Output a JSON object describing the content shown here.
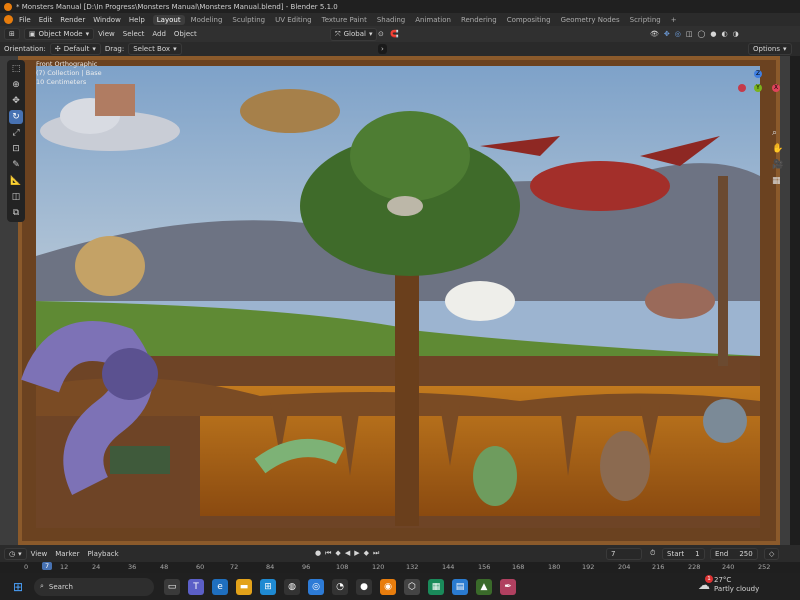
{
  "titlebar": {
    "title": "* Monsters Manual [D:\\In Progress\\Monsters Manual\\Monsters Manual.blend] - Blender 5.1.0"
  },
  "menu": {
    "items": [
      "File",
      "Edit",
      "Render",
      "Window",
      "Help"
    ]
  },
  "workspaces": [
    "Layout",
    "Modeling",
    "Sculpting",
    "UV Editing",
    "Texture Paint",
    "Shading",
    "Animation",
    "Rendering",
    "Compositing",
    "Geometry Nodes",
    "Scripting"
  ],
  "workspace_add": "+",
  "header": {
    "mode": "Object Mode",
    "menus": [
      "View",
      "Select",
      "Add",
      "Object"
    ],
    "transform_orientation": "Global",
    "options_label": "Options"
  },
  "toolheader": {
    "orientation_label": "Orientation:",
    "orientation_value": "Default",
    "drag_label": "Drag:",
    "drag_value": "Select Box"
  },
  "viewport_overlay": {
    "view_name": "Front Orthographic",
    "collection": "(7) Collection | Base",
    "scale": "10 Centimeters"
  },
  "gizmo": {
    "x": "X",
    "y": "Y",
    "z": "Z"
  },
  "timeline": {
    "menus": [
      "View",
      "Marker",
      "Playback"
    ],
    "current_frame": "7",
    "start_label": "Start",
    "start_value": "1",
    "end_label": "End",
    "end_value": "250"
  },
  "ruler": {
    "ticks": [
      "0",
      "7",
      "12",
      "24",
      "36",
      "48",
      "60",
      "72",
      "84",
      "96",
      "108",
      "120",
      "132",
      "144",
      "156",
      "168",
      "180",
      "192",
      "204",
      "216",
      "228",
      "240",
      "252"
    ]
  },
  "taskbar": {
    "search_placeholder": "Search",
    "weather_temp": "27°C",
    "weather_desc": "Partly cloudy",
    "weather_badge": "1"
  }
}
